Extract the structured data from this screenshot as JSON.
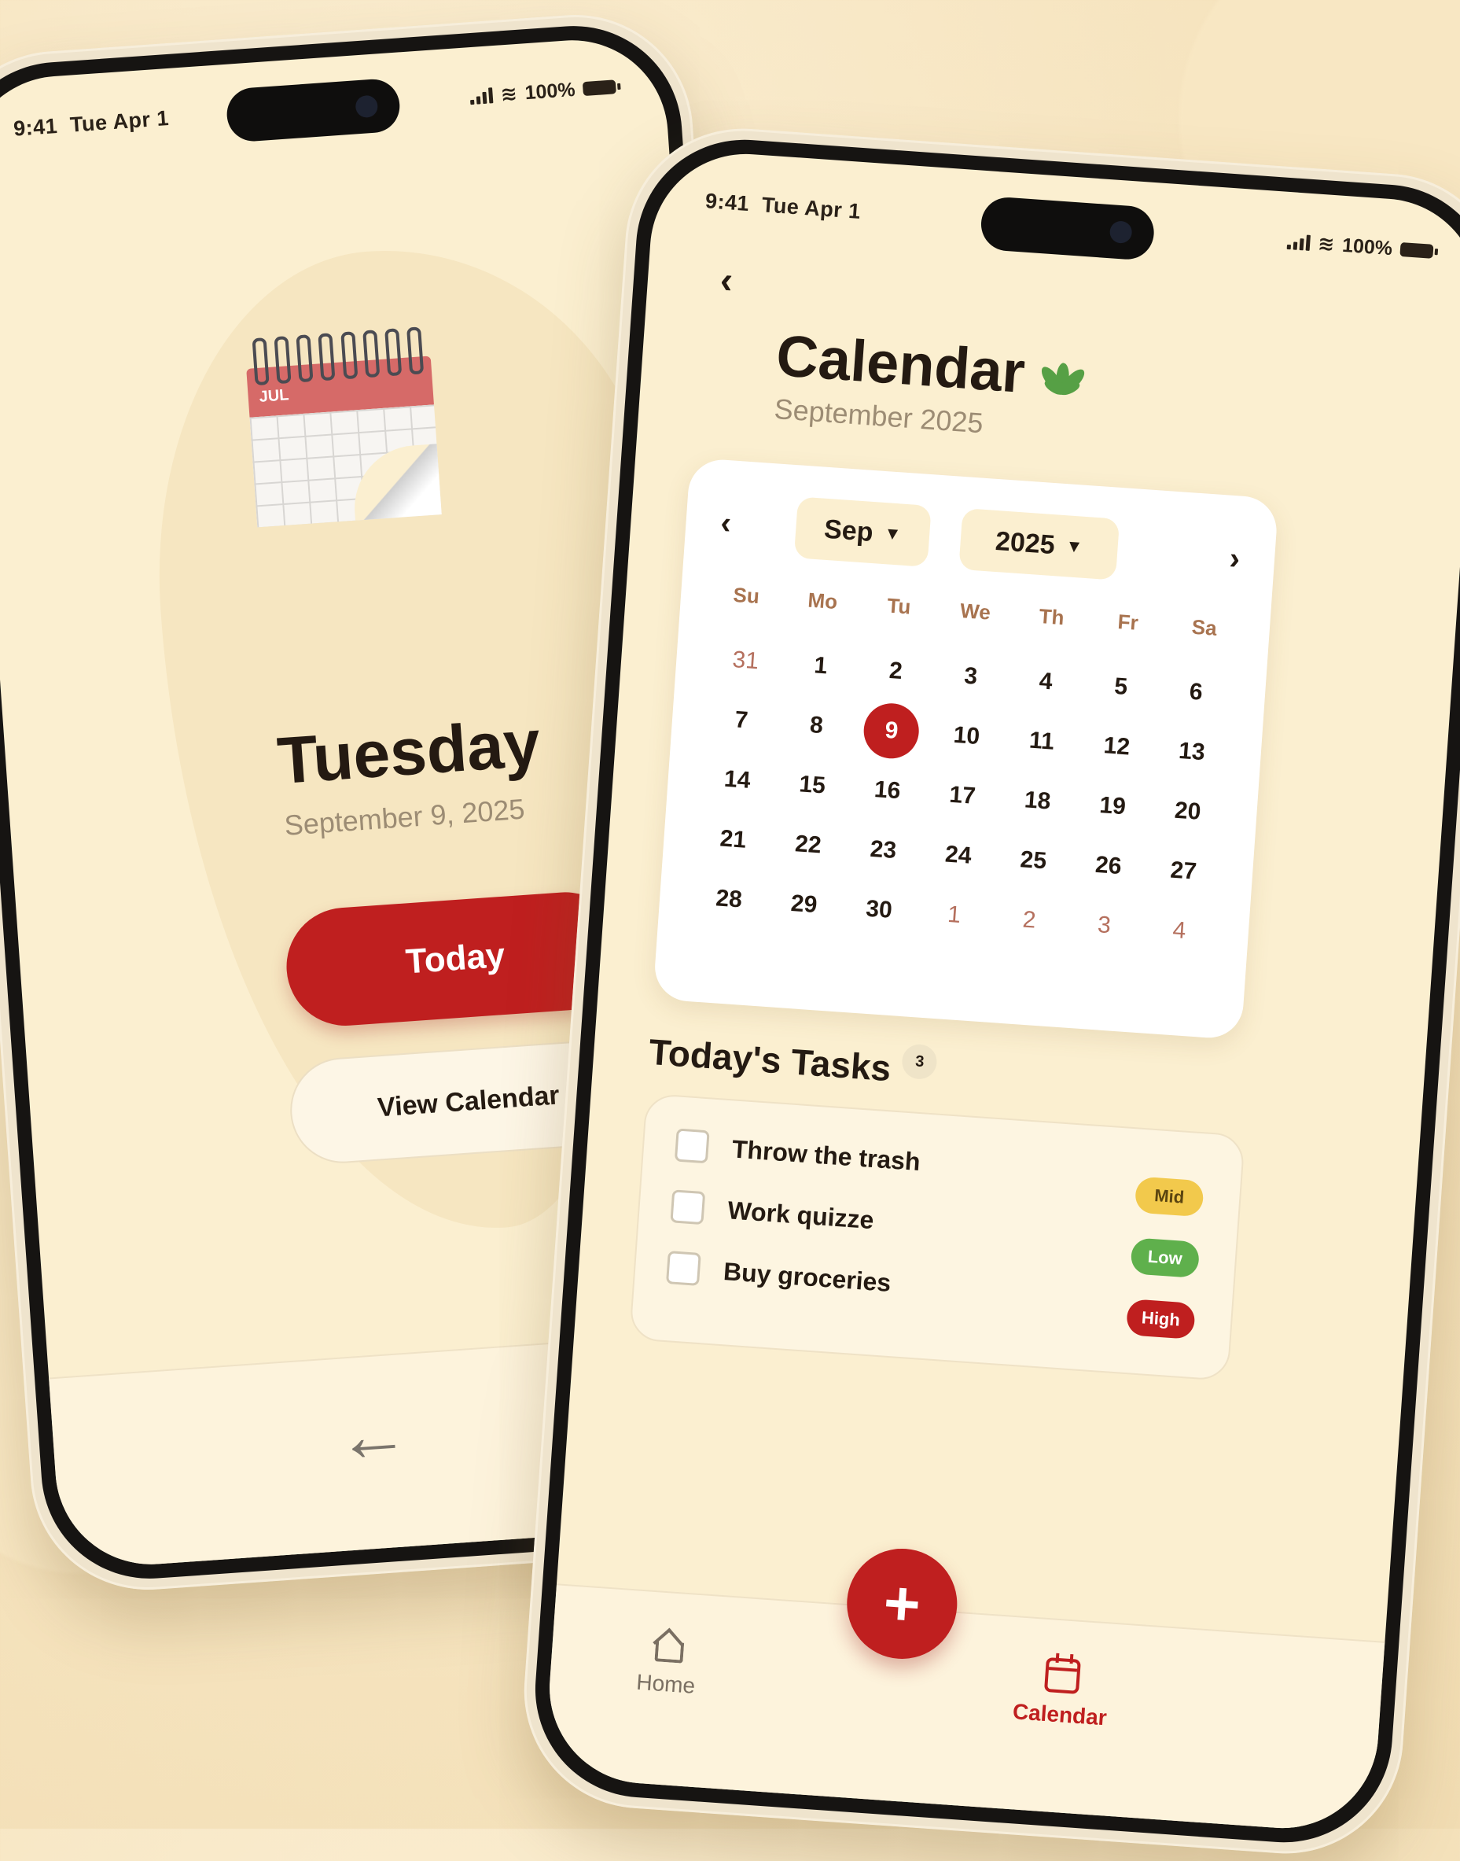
{
  "status_bar": {
    "time": "9:41",
    "date": "Tue Apr 1",
    "battery": "100%"
  },
  "home_screen": {
    "calendar_icon_month": "JUL",
    "day_name": "Tuesday",
    "full_date": "September 9, 2025",
    "today_button": "Today",
    "view_calendar_button": "View Calendar"
  },
  "calendar_screen": {
    "title": "Calendar",
    "subtitle": "September 2025",
    "month_select": "Sep",
    "year_select": "2025",
    "weekdays": [
      "Su",
      "Mo",
      "Tu",
      "We",
      "Th",
      "Fr",
      "Sa"
    ],
    "selected_day": "9",
    "days": [
      {
        "n": "31",
        "out": true
      },
      {
        "n": "1"
      },
      {
        "n": "2"
      },
      {
        "n": "3"
      },
      {
        "n": "4"
      },
      {
        "n": "5"
      },
      {
        "n": "6"
      },
      {
        "n": "7"
      },
      {
        "n": "8"
      },
      {
        "n": "9",
        "selected": true
      },
      {
        "n": "10"
      },
      {
        "n": "11"
      },
      {
        "n": "12"
      },
      {
        "n": "13"
      },
      {
        "n": "14"
      },
      {
        "n": "15"
      },
      {
        "n": "16"
      },
      {
        "n": "17"
      },
      {
        "n": "18"
      },
      {
        "n": "19"
      },
      {
        "n": "20"
      },
      {
        "n": "21"
      },
      {
        "n": "22"
      },
      {
        "n": "23"
      },
      {
        "n": "24"
      },
      {
        "n": "25"
      },
      {
        "n": "26"
      },
      {
        "n": "27"
      },
      {
        "n": "28"
      },
      {
        "n": "29"
      },
      {
        "n": "30"
      },
      {
        "n": "1",
        "out": true
      },
      {
        "n": "2",
        "out": true
      },
      {
        "n": "3",
        "out": true
      },
      {
        "n": "4",
        "out": true
      }
    ],
    "tasks_heading": "Today's Tasks",
    "tasks_count": "3",
    "tasks": [
      {
        "label": "Throw the trash",
        "checked": false
      },
      {
        "label": "Work quizze",
        "checked": false
      },
      {
        "label": "Buy groceries",
        "checked": false
      }
    ],
    "priority_badges": [
      {
        "label": "Mid",
        "color": "#f2c94c",
        "text_color": "#5a4410"
      },
      {
        "label": "Low",
        "color": "#5fb04c",
        "text_color": "#ffffff"
      },
      {
        "label": "High",
        "color": "#bf1f1f",
        "text_color": "#ffffff"
      }
    ],
    "fab_label": "+",
    "tabs": {
      "home": "Home",
      "calendar": "Calendar"
    },
    "active_tab": "calendar"
  },
  "colors": {
    "accent": "#bf1f1f",
    "background": "#fbefd0",
    "card": "#ffffff"
  }
}
